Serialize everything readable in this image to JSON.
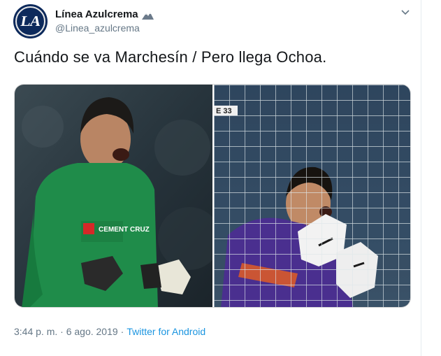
{
  "tweet": {
    "author": {
      "display_name": "Línea Azulcrema",
      "handle": "@Linea_azulcrema",
      "avatar_initials": "LA"
    },
    "text": "Cuándo se va Marchesín / Pero llega Ochoa.",
    "timestamp": "3:44 p. m. · 6 ago. 2019",
    "separator": "·",
    "source": "Twitter for Android"
  },
  "media": {
    "left_photo": {
      "jersey_text": "CEMENT CRUZ",
      "jersey_color": "#1f8c4a"
    },
    "right_photo": {
      "jersey_color": "#4a2f8f",
      "score_badge": "E 33"
    }
  },
  "colors": {
    "text_primary": "#14171a",
    "text_secondary": "#657786",
    "link": "#1b95e0",
    "avatar_bg": "#0d2a5c"
  }
}
